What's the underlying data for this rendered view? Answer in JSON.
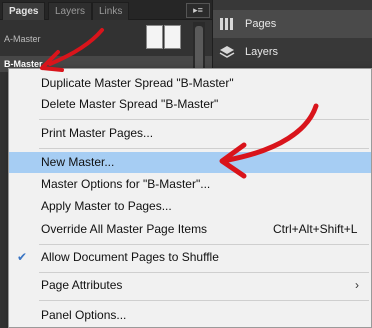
{
  "pages_panel": {
    "tabs": [
      {
        "label": "Pages"
      },
      {
        "label": "Layers"
      },
      {
        "label": "Links"
      }
    ],
    "menu_button": "▸≡",
    "masters": [
      {
        "label": "A-Master"
      },
      {
        "label": "B-Master"
      }
    ]
  },
  "dock": {
    "items": [
      {
        "label": "Pages",
        "icon": "pages-icon"
      },
      {
        "label": "Layers",
        "icon": "layers-icon"
      }
    ]
  },
  "context_menu": {
    "items": [
      {
        "label": "Duplicate Master Spread \"B-Master\""
      },
      {
        "label": "Delete Master Spread \"B-Master\""
      },
      {
        "label": "Print Master Pages..."
      },
      {
        "label": "New Master...",
        "highlighted": true
      },
      {
        "label": "Master Options for \"B-Master\"..."
      },
      {
        "label": "Apply Master to Pages..."
      },
      {
        "label": "Override All Master Page Items",
        "shortcut": "Ctrl+Alt+Shift+L"
      },
      {
        "label": "Allow Document Pages to Shuffle",
        "checked": true
      },
      {
        "label": "Page Attributes",
        "submenu": true
      },
      {
        "label": "Panel Options..."
      }
    ],
    "check_glyph": "✔",
    "submenu_glyph": "›"
  },
  "colors": {
    "highlight": "#a6cdf3",
    "annotation": "#d9141b",
    "check": "#3a75c4"
  }
}
